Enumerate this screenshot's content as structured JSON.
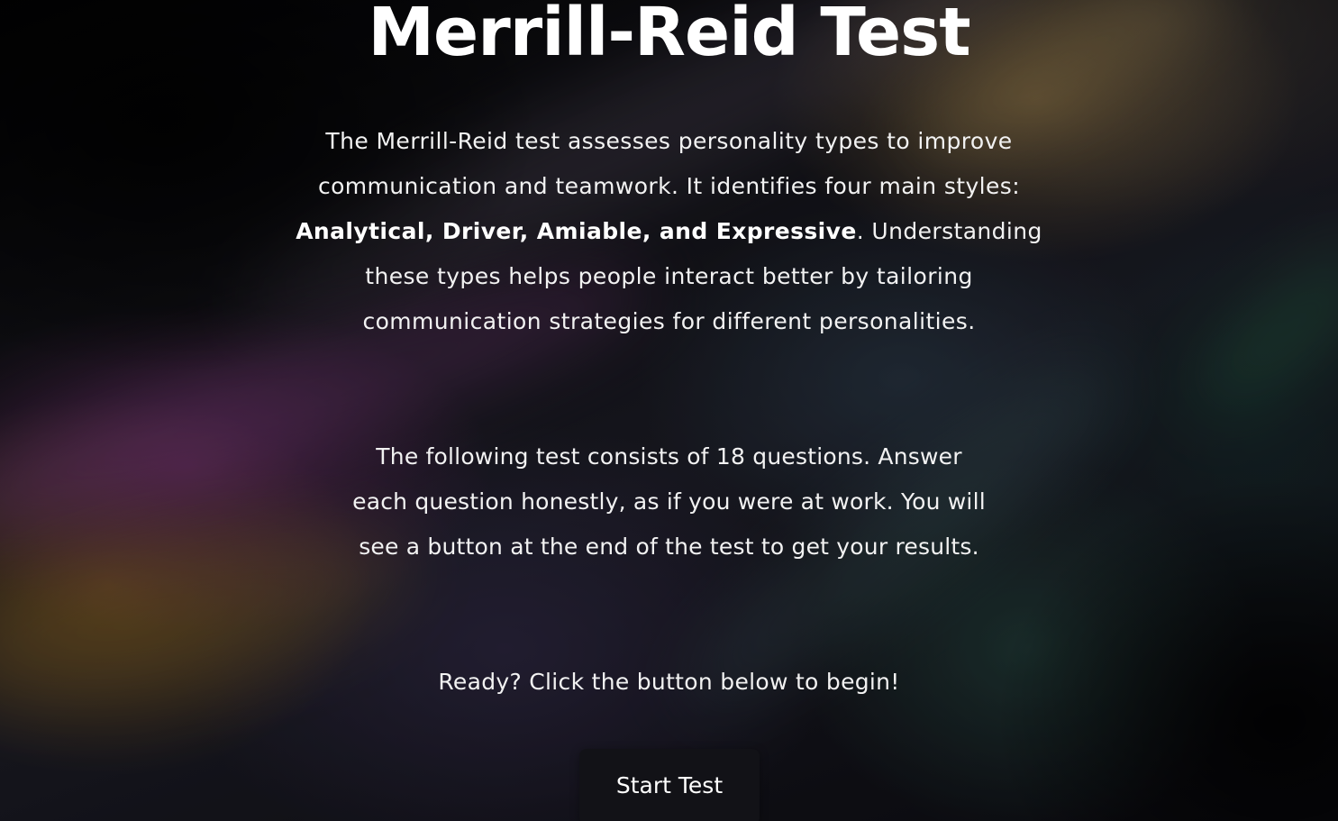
{
  "page": {
    "title": "Merrill-Reid Test",
    "intro": {
      "line1": "The Merrill-Reid test assesses personality types to improve",
      "line2": "communication and teamwork. It identifies four main styles:",
      "line3_bold": "Analytical, Driver, Amiable, and Expressive",
      "line3_rest": ". Understanding",
      "line4": "these types helps people interact better by tailoring",
      "line5": "communication strategies for different personalities."
    },
    "instructions": {
      "line1": "The following test consists of 18 questions. Answer",
      "line2": "each question honestly, as if you were at work. You will",
      "line3": "see a button at the end of the test to get your results."
    },
    "ready_text": "Ready? Click the button below to begin!",
    "start_button_label": "Start Test"
  }
}
